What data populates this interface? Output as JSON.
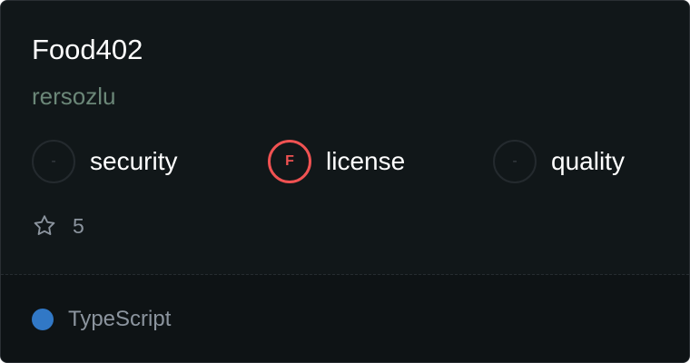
{
  "repo": {
    "name": "Food402",
    "owner": "rersozlu"
  },
  "scores": [
    {
      "label": "security",
      "grade": "-",
      "status": "none"
    },
    {
      "label": "license",
      "grade": "F",
      "status": "fail"
    },
    {
      "label": "quality",
      "grade": "-",
      "status": "none"
    }
  ],
  "stars": {
    "icon": "star-outline-icon",
    "count": "5"
  },
  "language": {
    "name": "TypeScript",
    "color": "#3178c6"
  },
  "colors": {
    "card_bg": "#111719",
    "fail_accent": "#f05252",
    "owner_text": "#6b8778"
  }
}
